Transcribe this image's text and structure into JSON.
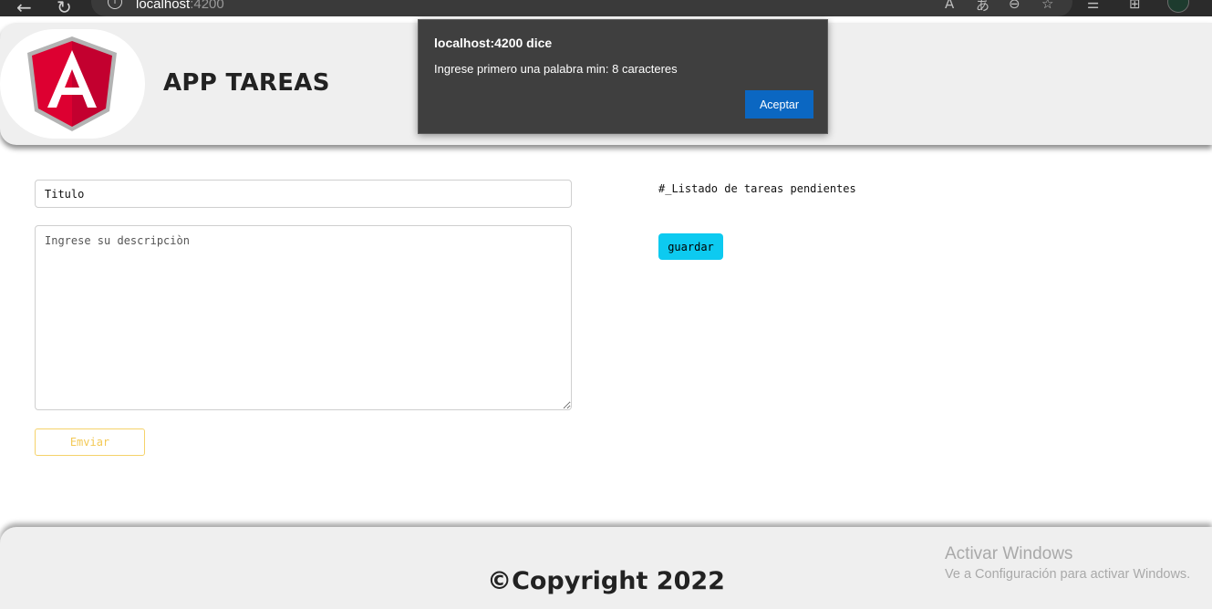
{
  "browser": {
    "url_host": "localhost",
    "url_port": ":4200",
    "back_icon": "arrow-left-icon",
    "reload_icon": "reload-icon"
  },
  "header": {
    "title": "APP TAREAS",
    "logo": "angular-logo",
    "logo_letter": "A",
    "logo_colors": {
      "left": "#dd0031",
      "right": "#c3002f",
      "border": "#b3b3b3"
    }
  },
  "form": {
    "title_value": "Titulo",
    "description_placeholder": "Ingrese su descripciòn",
    "send_label": "Emviar"
  },
  "list": {
    "heading": "#_Listado de tareas pendientes",
    "save_label": "guardar"
  },
  "footer": {
    "copyright": "©Copyright 2022"
  },
  "dialog": {
    "title": "localhost:4200 dice",
    "message": "Ingrese primero una palabra min: 8 caracteres",
    "ok_label": "Aceptar"
  },
  "windows_watermark": {
    "title": "Activar Windows",
    "subtitle": "Ve a Configuración para activar Windows."
  },
  "colors": {
    "accent_button": "#0dcaf0",
    "send_button": "#f3c955",
    "dialog_ok": "#0b67c2"
  }
}
